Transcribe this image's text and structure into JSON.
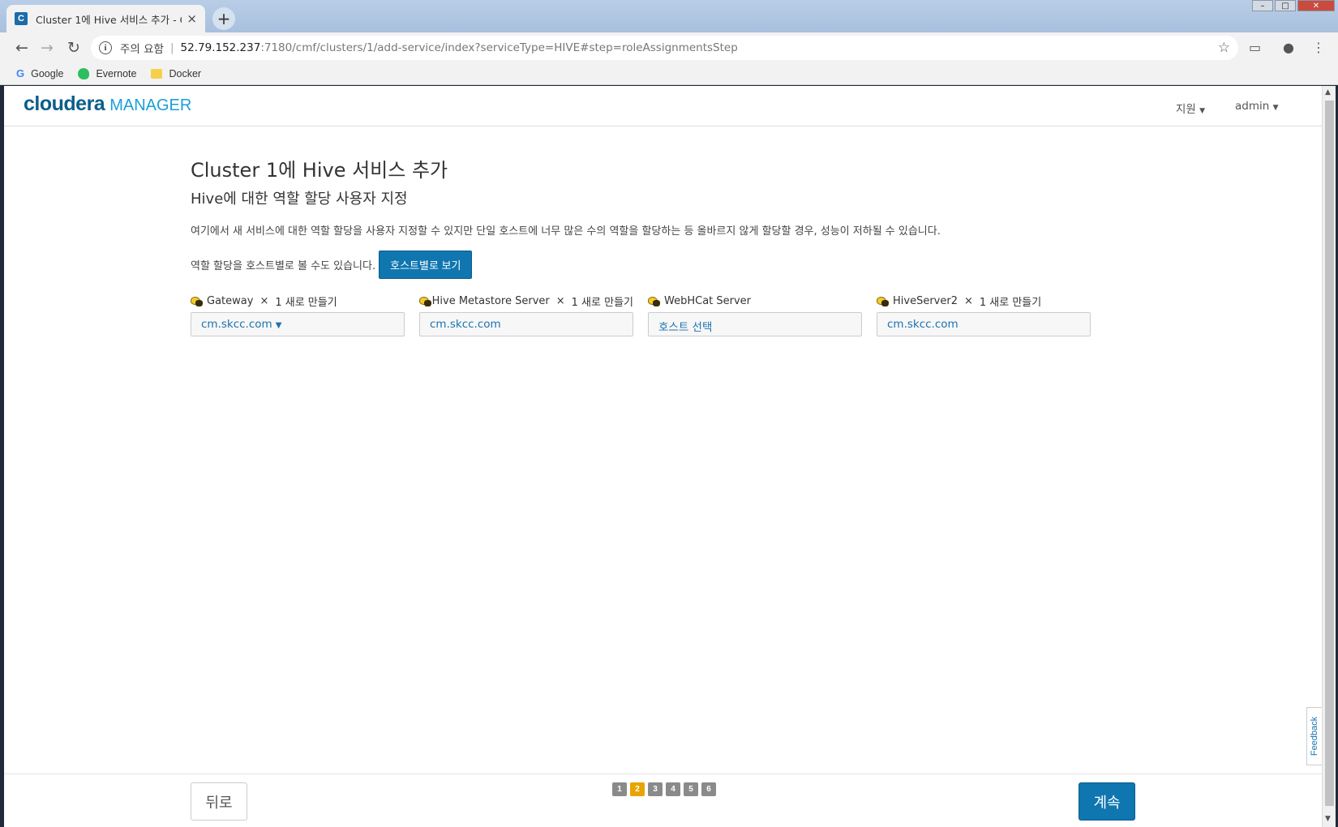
{
  "browser": {
    "tab_title": "Cluster 1에 Hive 서비스 추가 - C",
    "tab_favicon": "C",
    "new_tab": "+",
    "close_tab": "×",
    "security_label": "주의 요함",
    "separator": "|",
    "url_host": "52.79.152.237",
    "url_path": ":7180/cmf/clusters/1/add-service/index?serviceType=HIVE#step=roleAssignmentsStep",
    "bookmarks": [
      {
        "label": "Google",
        "icon": "google-icon"
      },
      {
        "label": "Evernote",
        "icon": "evernote-icon"
      },
      {
        "label": "Docker",
        "icon": "folder-icon"
      }
    ]
  },
  "header": {
    "logo_brand": "cloudera",
    "logo_product": "MANAGER",
    "support_menu": "지원",
    "user_menu": "admin"
  },
  "main": {
    "title": "Cluster 1에 Hive 서비스 추가",
    "subtitle": "Hive에 대한 역할 할당 사용자 지정",
    "description": "여기에서 새 서비스에 대한 역할 할당을 사용자 지정할 수 있지만 단일 호스트에 너무 많은 수의 역할을 할당하는 등 올바르지 않게 할당할 경우, 성능이 저하될 수 있습니다.",
    "by_host_text": "역할 할당을 호스트별로 볼 수도 있습니다.",
    "by_host_button": "호스트별로 보기",
    "roles": [
      {
        "name": "Gateway",
        "times": "×",
        "count": "1 새로 만들기",
        "host": "cm.skcc.com",
        "dropdown": true
      },
      {
        "name": "Hive Metastore Server",
        "times": "×",
        "count": "1 새로 만들기",
        "host": "cm.skcc.com",
        "dropdown": false
      },
      {
        "name": "WebHCat Server",
        "times": "",
        "count": "",
        "host": "호스트 선택",
        "dropdown": false
      },
      {
        "name": "HiveServer2",
        "times": "×",
        "count": "1 새로 만들기",
        "host": "cm.skcc.com",
        "dropdown": false
      }
    ]
  },
  "footer": {
    "back_label": "뒤로",
    "continue_label": "계속",
    "steps": [
      "1",
      "2",
      "3",
      "4",
      "5",
      "6"
    ],
    "current_step": "2"
  },
  "feedback_label": "Feedback",
  "colors": {
    "primary": "#0f76b0",
    "step_active": "#e8a400",
    "step_inactive": "#8a8a8a",
    "link": "#1a73b0"
  }
}
